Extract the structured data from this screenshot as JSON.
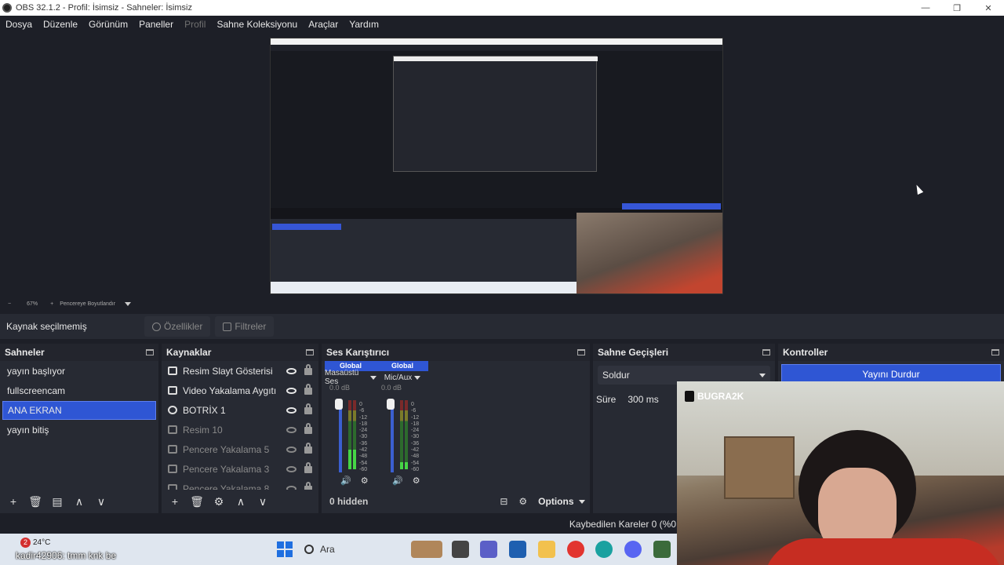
{
  "window": {
    "title": "OBS 32.1.2 - Profil: İsimsiz - Sahneler: İsimsiz",
    "controls": [
      "—",
      "❐",
      "✕"
    ]
  },
  "menu": [
    "Dosya",
    "Düzenle",
    "Görünüm",
    "Paneller",
    "Profil",
    "Sahne Koleksiyonu",
    "Araçlar",
    "Yardım"
  ],
  "zoom": {
    "minus": "−",
    "level": "67%",
    "plus": "+",
    "fit": "Pencereye Boyutlandır"
  },
  "context": {
    "label": "Kaynak seçilmemiş",
    "properties": "Özellikler",
    "filters": "Filtreler"
  },
  "scenes": {
    "title": "Sahneler",
    "items": [
      "yayın başlıyor",
      "fullscreencam",
      "ANA EKRAN",
      "yayın bitiş"
    ],
    "selected_index": 2
  },
  "sources": {
    "title": "Kaynaklar",
    "items": [
      {
        "name": "Resim Slayt Gösterisi",
        "visible": true
      },
      {
        "name": "Video Yakalama Aygıtı",
        "visible": true
      },
      {
        "name": "BOTRİX 1",
        "visible": true
      },
      {
        "name": "Resim 10",
        "visible": false
      },
      {
        "name": "Pencere Yakalama 5",
        "visible": false
      },
      {
        "name": "Pencere Yakalama 3",
        "visible": false
      },
      {
        "name": "Pencere Yakalama 8",
        "visible": false
      }
    ]
  },
  "mixer": {
    "title": "Ses Karıştırıcı",
    "channels": [
      {
        "tag": "Global",
        "name": "Masaüstü Ses",
        "db": "0.0 dB",
        "level": 0.28
      },
      {
        "tag": "Global",
        "name": "Mic/Aux",
        "db": "0.0 dB",
        "level": 0.1
      }
    ],
    "ticks": [
      "0",
      "-6",
      "-12",
      "-18",
      "-24",
      "-30",
      "-36",
      "-42",
      "-48",
      "-54",
      "-60"
    ],
    "hidden": "0 hidden",
    "options": "Options"
  },
  "transitions": {
    "title": "Sahne Geçişleri",
    "selected": "Soldur",
    "duration_label": "Süre",
    "duration_value": "300 ms"
  },
  "controls": {
    "title": "Kontroller",
    "stream_button": "Yayını Durdur"
  },
  "status": {
    "dropped_frames": "Kaybedilen Kareler 0 (%0"
  },
  "webcam": {
    "handle": "BUGRA2K"
  },
  "taskbar": {
    "weather": "24°C",
    "weather_badge": "2",
    "chat_user": "kadir42906",
    "chat_message": ": tmm knk be",
    "search": "Ara"
  }
}
